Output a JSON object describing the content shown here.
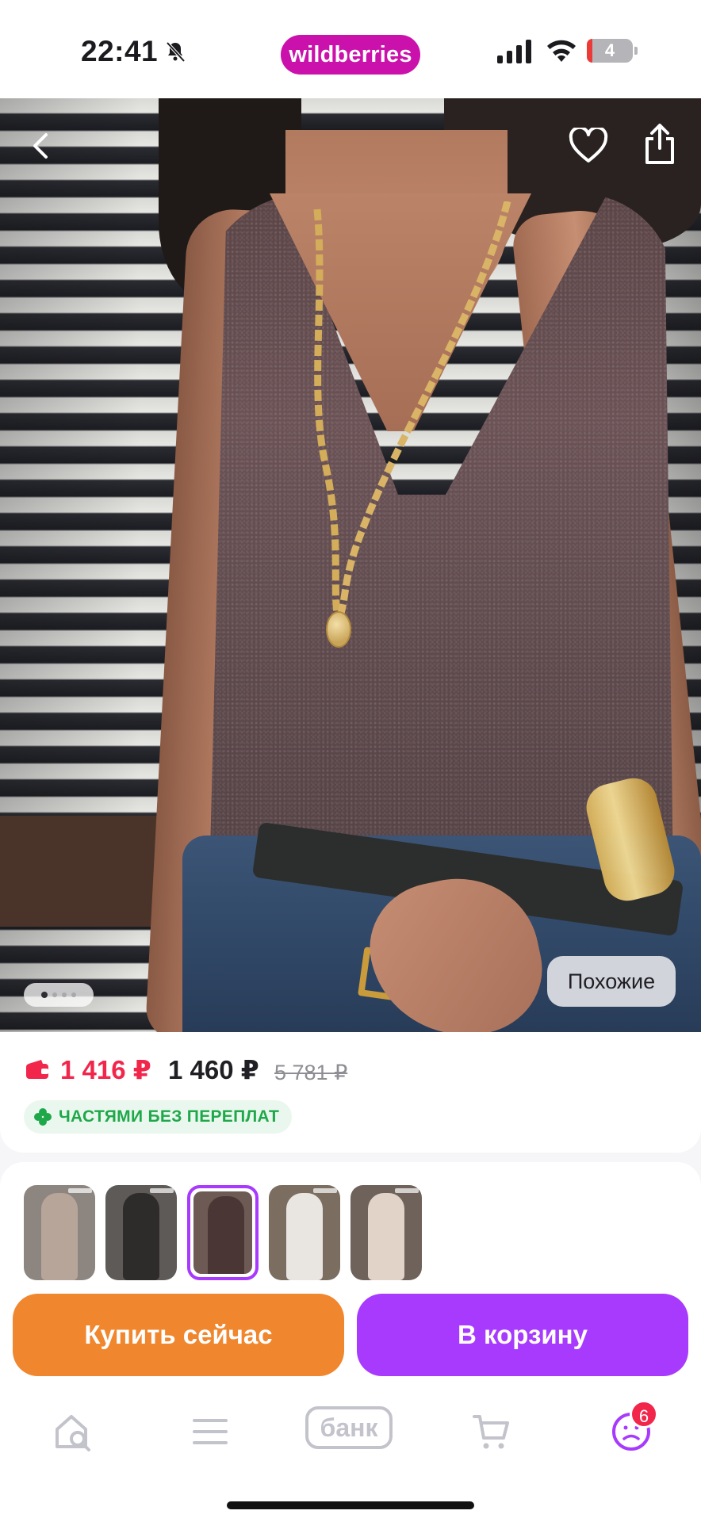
{
  "status_bar": {
    "time": "22:41",
    "brand": "wildberries",
    "battery": "4"
  },
  "product": {
    "image_alt": "Women's sleeveless knit top",
    "similar_label": "Похожие",
    "gallery_index": 1,
    "gallery_total": 4
  },
  "price": {
    "wallet_price": "1 416 ₽",
    "price": "1 460 ₽",
    "old_price": "5 781 ₽",
    "installments": "ЧАСТЯМИ БЕЗ ПЕРЕПЛАТ"
  },
  "variants": {
    "items": [
      {
        "name": "variant-beige",
        "color": "#b8a59a"
      },
      {
        "name": "variant-black",
        "color": "#2e2b2b"
      },
      {
        "name": "variant-brown",
        "color": "#5e4440",
        "selected": true
      },
      {
        "name": "variant-white",
        "color": "#e9e6e1"
      },
      {
        "name": "variant-cream",
        "color": "#e2d3c8"
      }
    ]
  },
  "actions": {
    "buy_now": "Купить сейчас",
    "add_to_cart": "В корзину"
  },
  "tabbar": {
    "bank": "банк",
    "cart_badge": "6"
  },
  "colors": {
    "brand": "#cb11ab",
    "price_red": "#f2264b",
    "buy_orange": "#f0862d",
    "cart_purple": "#a73afd",
    "installments_green": "#1fa84a"
  }
}
